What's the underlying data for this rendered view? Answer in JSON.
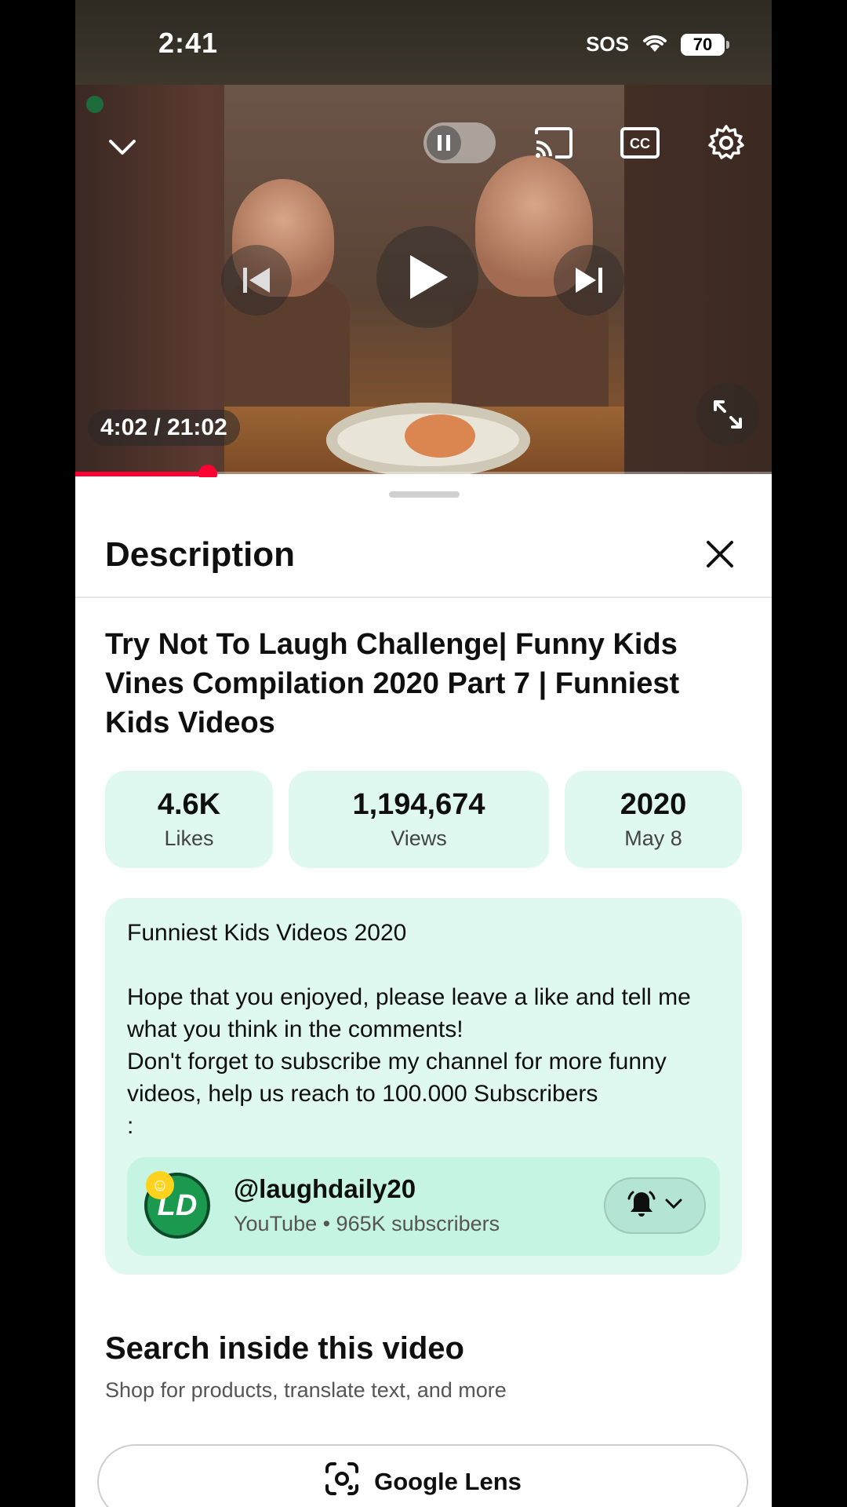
{
  "status_bar": {
    "time": "2:41",
    "sos": "SOS",
    "battery": "70"
  },
  "player": {
    "time_display": "4:02 / 21:02",
    "progress_fraction": 0.19,
    "icons": [
      "chevron-down-icon",
      "pause-icon",
      "cast-icon",
      "cc-icon",
      "gear-icon",
      "previous-icon",
      "play-icon",
      "next-icon",
      "fullscreen-icon"
    ]
  },
  "sheet": {
    "title": "Description",
    "video_title": "Try Not To Laugh Challenge| Funny Kids Vines Compilation 2020 Part 7 | Funniest Kids Videos",
    "stats": [
      {
        "value": "4.6K",
        "label": "Likes"
      },
      {
        "value": "1,194,674",
        "label": "Views"
      },
      {
        "value": "2020",
        "label": "May 8"
      }
    ],
    "description": "Funniest Kids Videos 2020\n\nHope that you enjoyed, please leave a like and tell me what you think in the comments!\nDon't forget to subscribe my channel for more funny videos, help us reach to 100.000 Subscribers\n:",
    "channel": {
      "avatar_text": "LD",
      "name": "@laughdaily20",
      "subtitle": "YouTube • 965K subscribers"
    },
    "search_section": {
      "title": "Search inside this video",
      "subtitle": "Shop for products, translate text, and more",
      "lens_label": "Google Lens"
    }
  },
  "colors": {
    "accent_red": "#ff0033",
    "mint_bg": "#dff8f0",
    "mint_card": "#c6f4e3"
  }
}
